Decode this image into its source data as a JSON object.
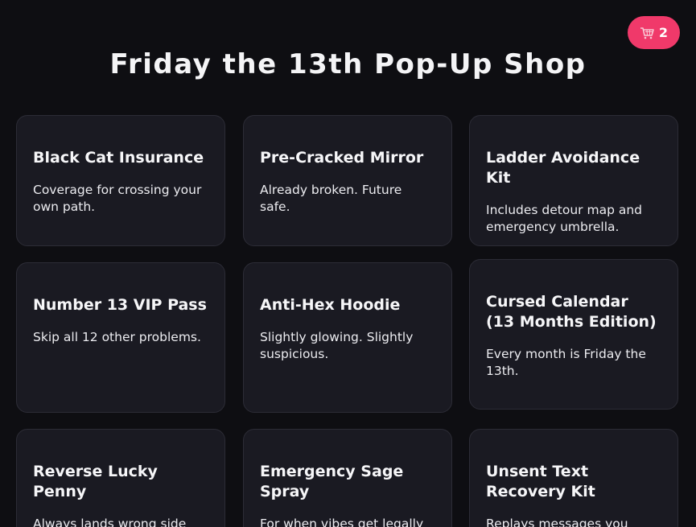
{
  "cart": {
    "icon": "shopping-cart-icon",
    "count": "2",
    "color": "#f0396a"
  },
  "page_title": "Friday the 13th Pop-Up Shop",
  "products": [
    {
      "title": "Black Cat Insurance",
      "desc": "Coverage for crossing your own path."
    },
    {
      "title": "Pre-Cracked Mirror",
      "desc": "Already broken. Future safe."
    },
    {
      "title": "Ladder Avoidance Kit",
      "desc": "Includes detour map and emergency umbrella."
    },
    {
      "title": "Number 13 VIP Pass",
      "desc": "Skip all 12 other problems."
    },
    {
      "title": "Anti-Hex Hoodie",
      "desc": "Slightly glowing. Slightly suspicious."
    },
    {
      "title": "Cursed Calendar (13 Months Edition)",
      "desc": "Every month is Friday the 13th."
    },
    {
      "title": "Reverse Lucky Penny",
      "desc": "Always lands wrong side up."
    },
    {
      "title": "Emergency Sage Spray",
      "desc": "For when vibes get legally concerning."
    },
    {
      "title": "Unsent Text Recovery Kit",
      "desc": "Replays messages you"
    }
  ]
}
